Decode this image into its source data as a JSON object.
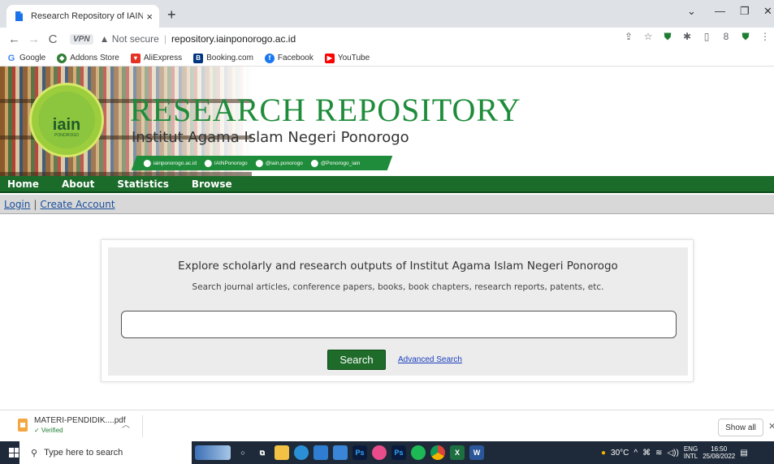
{
  "browser": {
    "tab_title": "Research Repository of IAIN Pono",
    "new_tab": "+",
    "tab_close": "×",
    "window_controls": [
      "⌄",
      "—",
      "❐",
      "✕"
    ],
    "vpn_label": "VPN",
    "not_secure": "Not secure",
    "url": "repository.iainponorogo.ac.id",
    "bookmarks": [
      "Google",
      "Addons Store",
      "AliExpress",
      "Booking.com",
      "Facebook",
      "YouTube"
    ]
  },
  "banner": {
    "title": "RESEARCH REPOSITORY",
    "subtitle": "Institut Agama Islam Negeri Ponorogo",
    "logo_text": "iain",
    "logo_sub": "PONOROGO",
    "social": [
      "iainponorogo.ac.id",
      "IAINPonorogo",
      "@iain.ponorogo",
      "@Ponorogo_iain"
    ]
  },
  "nav": {
    "items": [
      "Home",
      "About",
      "Statistics",
      "Browse"
    ]
  },
  "subnav": {
    "login": "Login",
    "separator": "|",
    "create_account": "Create Account"
  },
  "search": {
    "headline": "Explore scholarly and research outputs of Institut Agama Islam Negeri Ponorogo",
    "subline": "Search journal articles, conference papers, books, book chapters, research reports, patents, etc.",
    "query": "",
    "button": "Search",
    "advanced": "Advanced Search"
  },
  "download": {
    "filename": "MATERI-PENDIDIK....pdf",
    "status": "✓ Verified",
    "show_all": "Show all"
  },
  "taskbar": {
    "search_placeholder": "Type here to search",
    "weather": "30°C",
    "lang_top": "ENG",
    "lang_bottom": "INTL",
    "time": "16:50",
    "date": "25/08/2022"
  },
  "colors": {
    "brand_green": "#1e8c3a",
    "nav_green": "#1b6b2b",
    "link_blue": "#1a4f9c"
  }
}
